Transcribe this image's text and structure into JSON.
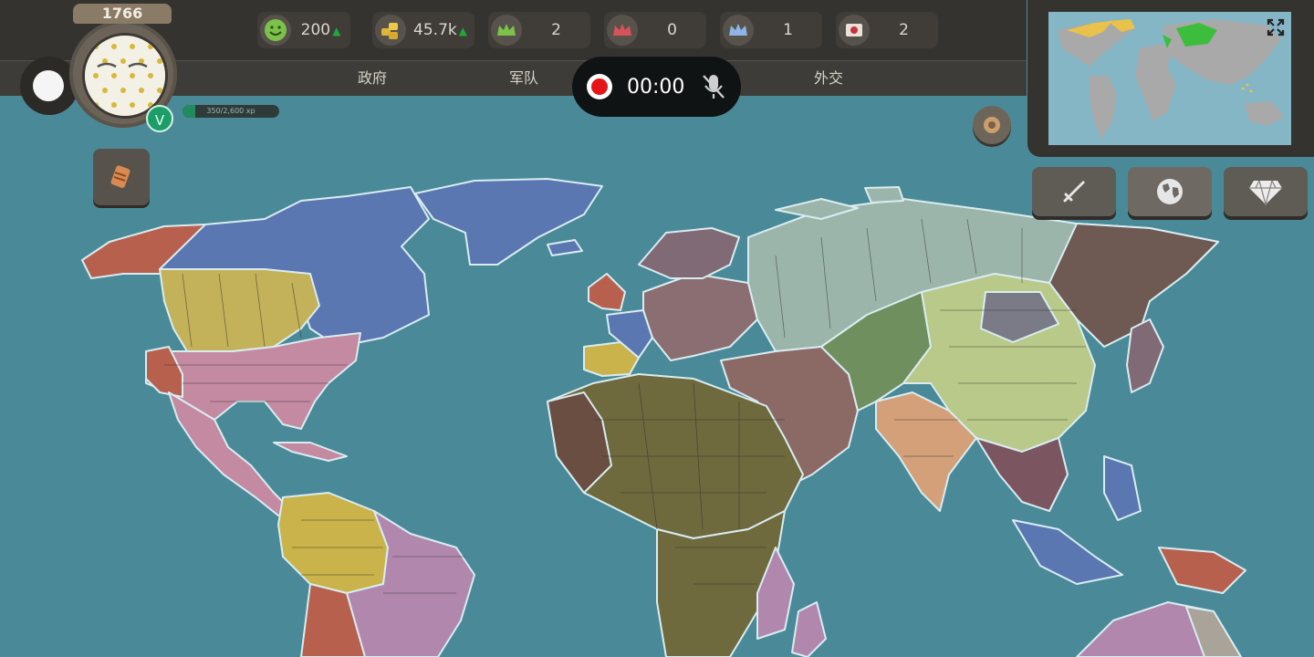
{
  "header": {
    "year": "1766",
    "resources": [
      {
        "icon": "happiness-icon",
        "value": "200",
        "trend": "up"
      },
      {
        "icon": "gold-coins-icon",
        "value": "45.7k",
        "trend": "up"
      },
      {
        "icon": "crown-green-icon",
        "value": "2"
      },
      {
        "icon": "crown-red-icon",
        "value": "0"
      },
      {
        "icon": "crown-blue-icon",
        "value": "1"
      },
      {
        "icon": "flag-icon",
        "value": "2"
      }
    ],
    "tabs": [
      "政府",
      "军队",
      "",
      "外交"
    ]
  },
  "player": {
    "level_badge": "V",
    "xp_text": "350/2,600 xp",
    "xp_fraction": 0.13
  },
  "recorder": {
    "time": "00:00"
  },
  "colors": {
    "ocean": "#4a8a98",
    "topbar": "#35332f",
    "resource_up": "#1fa83a",
    "record": "#e4141b"
  },
  "right_buttons": [
    {
      "icon": "sword-icon"
    },
    {
      "icon": "globe-icon"
    },
    {
      "icon": "diamond-icon"
    }
  ]
}
